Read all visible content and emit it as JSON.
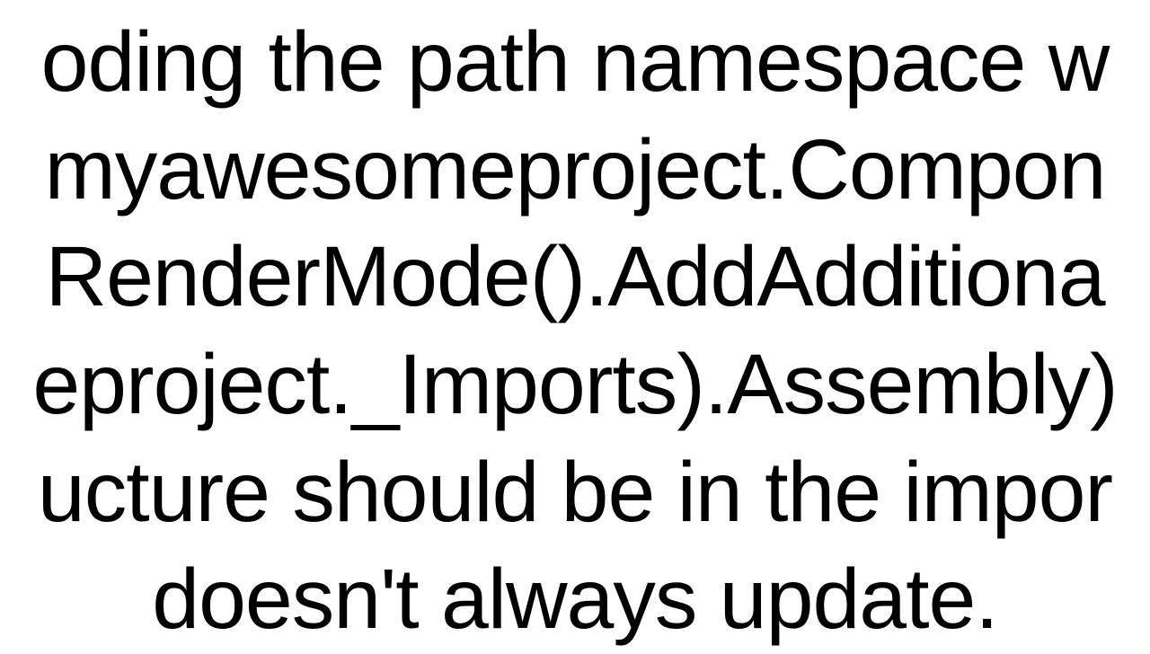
{
  "document": {
    "lines": {
      "l1": "oding the path namespace w",
      "l2": "myawesomeproject.Compon",
      "l3": "RenderMode().AddAdditiona",
      "l4": "eproject._Imports).Assembly)",
      "l5": "ucture should be in the impor",
      "l6": "doesn't always update."
    }
  }
}
